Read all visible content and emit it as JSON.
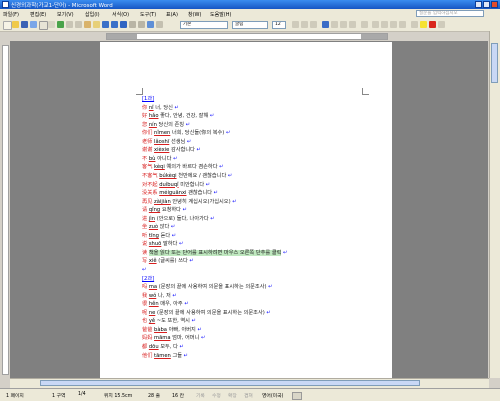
{
  "window": {
    "title": "신경외과학(가교1-단어) - Microsoft Word",
    "help_placeholder": "질문을 입력하십시오"
  },
  "menu": [
    "파일(F)",
    "편집(E)",
    "보기(V)",
    "삽입(I)",
    "서식(O)",
    "도구(T)",
    "표(A)",
    "창(W)",
    "도움말(H)"
  ],
  "toolbar": {
    "style": "기본",
    "font": "굴림",
    "size": "12"
  },
  "document": {
    "lines": [
      {
        "type": "heading",
        "text": "[1과]"
      },
      {
        "hanzi": "你",
        "pinyin": "nǐ",
        "meaning": "너, 당신"
      },
      {
        "hanzi": "好",
        "pinyin": "hǎo",
        "meaning": "좋다, 안녕, 건강, 잘해"
      },
      {
        "hanzi": "您",
        "pinyin": "nín",
        "meaning": "당신의 존칭"
      },
      {
        "hanzi": "你们",
        "pinyin": "nǐmen",
        "meaning": "너희, 당신들(你의 복수)"
      },
      {
        "hanzi": "老师",
        "pinyin": "lǎoshī",
        "meaning": "선생님"
      },
      {
        "hanzi": "谢谢",
        "pinyin": "xièxie",
        "meaning": "감사합니다"
      },
      {
        "hanzi": "不",
        "pinyin": "bù",
        "meaning": "아니다"
      },
      {
        "hanzi": "客气",
        "pinyin": "kèqi",
        "meaning": "예의가 바르다 겸손하다"
      },
      {
        "hanzi": "不客气",
        "pinyin": "búkèqi",
        "meaning": "천만에요 / 괜찮습니다"
      },
      {
        "hanzi": "对不起",
        "pinyin": "duìbuqǐ",
        "meaning": "미안합니다"
      },
      {
        "hanzi": "没关系",
        "pinyin": "méiguānxi",
        "meaning": "괜찮습니다"
      },
      {
        "hanzi": "再见",
        "pinyin": "zàijiàn",
        "meaning": "안녕히 계십시오(가십시오)"
      },
      {
        "hanzi": "请",
        "pinyin": "qǐng",
        "meaning": "요청하다"
      },
      {
        "hanzi": "进",
        "pinyin": "jìn",
        "meaning": "(안으로) 들다, 나아가다"
      },
      {
        "hanzi": "坐",
        "pinyin": "zuò",
        "meaning": "앉다"
      },
      {
        "hanzi": "听",
        "pinyin": "tīng",
        "meaning": "듣다"
      },
      {
        "hanzi": "说",
        "pinyin": "shuō",
        "meaning": "말하다"
      },
      {
        "hanzi": "读",
        "pinyin": "",
        "meaning": "책을 읽다 또는 단어를 표시하려면 마우스 오른쪽 단추를 클릭"
      },
      {
        "hanzi": "写",
        "pinyin": "xiě",
        "meaning": "(글씨를) 쓰다"
      },
      {
        "type": "blank",
        "text": ""
      },
      {
        "type": "heading",
        "text": "[2과]"
      },
      {
        "hanzi": "吗",
        "pinyin": "ma",
        "meaning": "(문장의 끝에 사용하여 의문을 표시하는 의문조사)"
      },
      {
        "hanzi": "我",
        "pinyin": "wǒ",
        "meaning": "나, 저"
      },
      {
        "hanzi": "很",
        "pinyin": "hěn",
        "meaning": "매우, 아주"
      },
      {
        "hanzi": "呢",
        "pinyin": "ne",
        "meaning": "(문장의 끝에 사용하여 의문을 표시하는 의문조사)"
      },
      {
        "hanzi": "也",
        "pinyin": "yě",
        "meaning": "~도 또한, 역시"
      },
      {
        "hanzi": "爸爸",
        "pinyin": "bàba",
        "meaning": "아빠, 아버지"
      },
      {
        "hanzi": "妈妈",
        "pinyin": "māma",
        "meaning": "엄마, 어머니"
      },
      {
        "hanzi": "都",
        "pinyin": "dōu",
        "meaning": "모두, 다"
      },
      {
        "hanzi": "他们",
        "pinyin": "tāmen",
        "meaning": "그들"
      }
    ]
  },
  "status": {
    "page": "1 페이지",
    "section": "1 구역",
    "pages": "1/4",
    "position": "위치 15.5cm",
    "line": "28 줄",
    "col": "16 칸",
    "modes": [
      "기록",
      "수정",
      "확장",
      "겹쳐"
    ],
    "language": "영어(미국)"
  }
}
